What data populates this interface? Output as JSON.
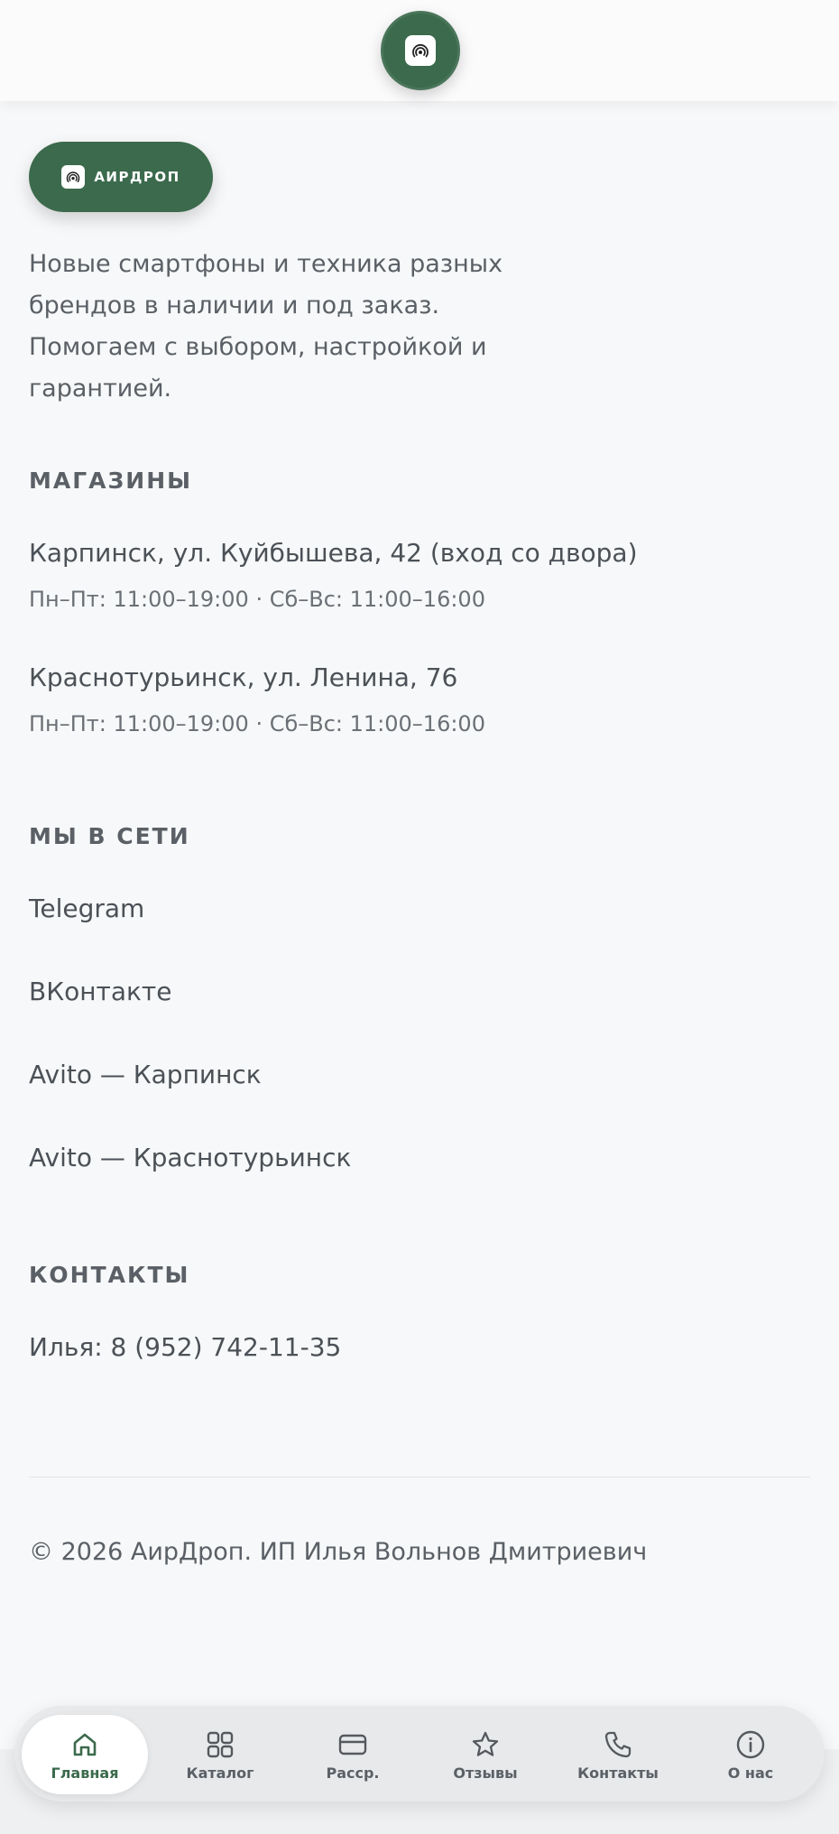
{
  "header": {
    "logo_icon": "airdrop-icon"
  },
  "brand": {
    "name": "АИРДРОП",
    "logo_icon": "airdrop-icon"
  },
  "intro": {
    "text": "Новые смартфоны и техника разных брендов в наличии и под заказ. Помогаем с выбором, настройкой и гарантией."
  },
  "stores": {
    "title": "МАГАЗИНЫ",
    "items": [
      {
        "address": "Карпинск, ул. Куйбышева, 42 (вход со двора)",
        "hours": "Пн–Пт: 11:00–19:00 · Сб–Вс: 11:00–16:00"
      },
      {
        "address": "Краснотурьинск, ул. Ленина, 76",
        "hours": "Пн–Пт: 11:00–19:00 · Сб–Вс: 11:00–16:00"
      }
    ]
  },
  "social": {
    "title": "МЫ В СЕТИ",
    "links": [
      "Telegram",
      "ВКонтакте",
      "Avito — Карпинск",
      "Avito — Краснотурьинск"
    ]
  },
  "contacts": {
    "title": "КОНТАКТЫ",
    "phone": "Илья: 8 (952) 742-11-35"
  },
  "footer": {
    "copyright": "© 2026 АирДроп. ИП Илья Вольнов Дмитриевич"
  },
  "bottom_nav": {
    "items": [
      {
        "label": "Главная",
        "icon": "home-icon",
        "active": true
      },
      {
        "label": "Каталог",
        "icon": "grid-icon",
        "active": false
      },
      {
        "label": "Расср.",
        "icon": "card-icon",
        "active": false
      },
      {
        "label": "Отзывы",
        "icon": "star-icon",
        "active": false
      },
      {
        "label": "Контакты",
        "icon": "phone-icon",
        "active": false
      },
      {
        "label": "О нас",
        "icon": "info-icon",
        "active": false
      }
    ]
  },
  "colors": {
    "brand_green": "#3b6a4c",
    "background": "#f7f8f9",
    "text": "#4b5157"
  }
}
